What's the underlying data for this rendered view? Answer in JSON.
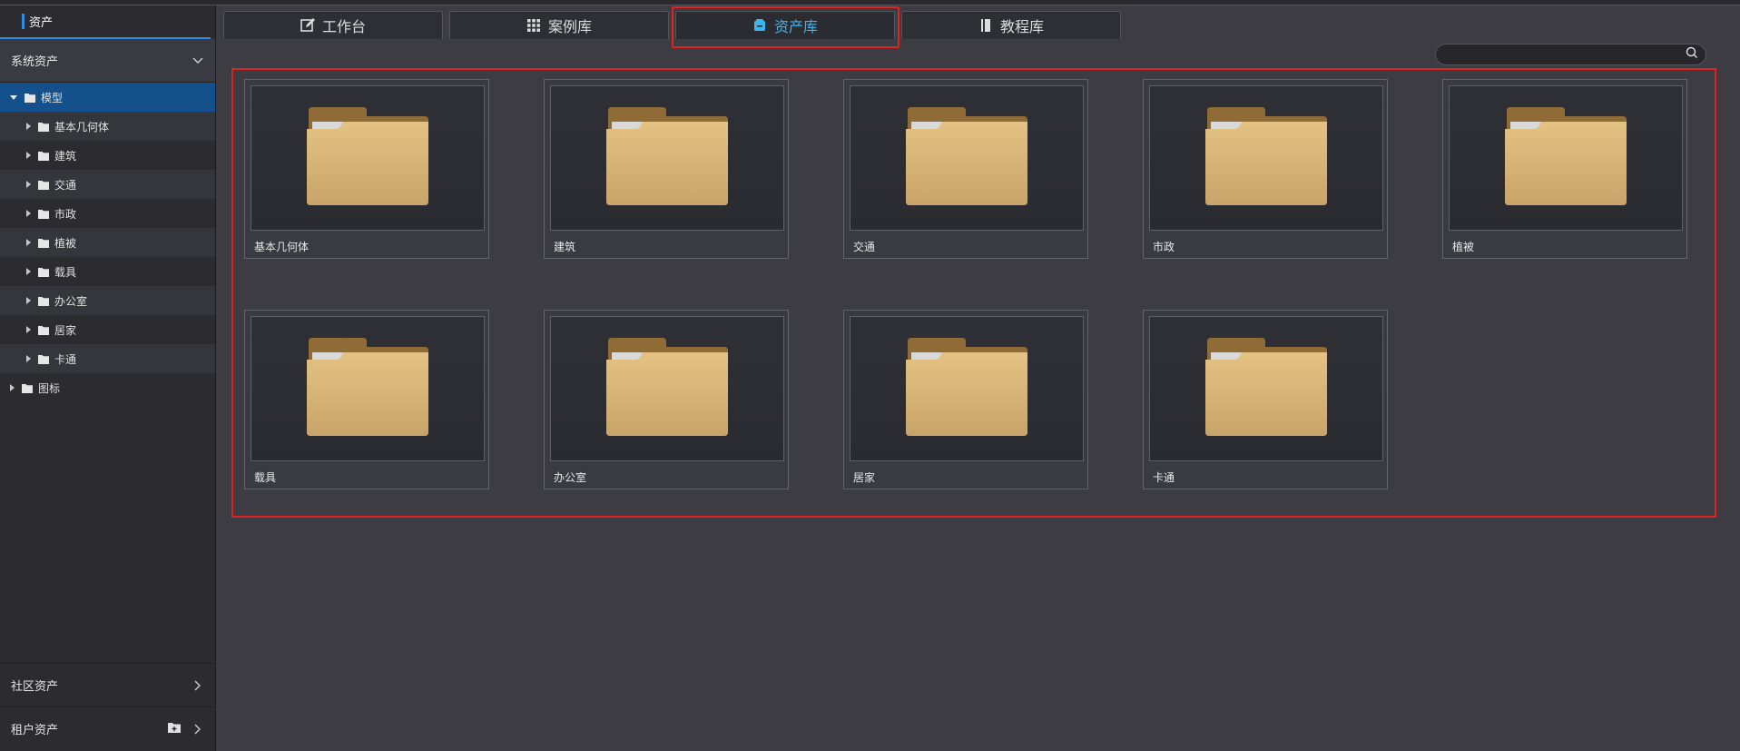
{
  "sidebar": {
    "title": "资产",
    "system_section": "系统资产",
    "tree": [
      {
        "label": "模型",
        "level": 0,
        "expanded": true,
        "selected": true
      },
      {
        "label": "基本几何体",
        "level": 1
      },
      {
        "label": "建筑",
        "level": 1
      },
      {
        "label": "交通",
        "level": 1
      },
      {
        "label": "市政",
        "level": 1
      },
      {
        "label": "植被",
        "level": 1
      },
      {
        "label": "载具",
        "level": 1
      },
      {
        "label": "办公室",
        "level": 1
      },
      {
        "label": "居家",
        "level": 1
      },
      {
        "label": "卡通",
        "level": 1
      },
      {
        "label": "图标",
        "level": 0
      }
    ],
    "community_section": "社区资产",
    "tenant_section": "租户资产"
  },
  "tabs": [
    {
      "label": "工作台",
      "icon": "edit-icon"
    },
    {
      "label": "案例库",
      "icon": "grid-icon"
    },
    {
      "label": "资产库",
      "icon": "asset-box-icon",
      "active": true
    },
    {
      "label": "教程库",
      "icon": "book-icon"
    }
  ],
  "search": {
    "placeholder": "",
    "value": ""
  },
  "folders": [
    "基本几何体",
    "建筑",
    "交通",
    "市政",
    "植被",
    "载具",
    "办公室",
    "居家",
    "卡通"
  ],
  "colors": {
    "accent": "#3bb6f0",
    "selected_bg": "#14508c",
    "highlight_border": "#e0231f",
    "folder": "#d7b374"
  }
}
